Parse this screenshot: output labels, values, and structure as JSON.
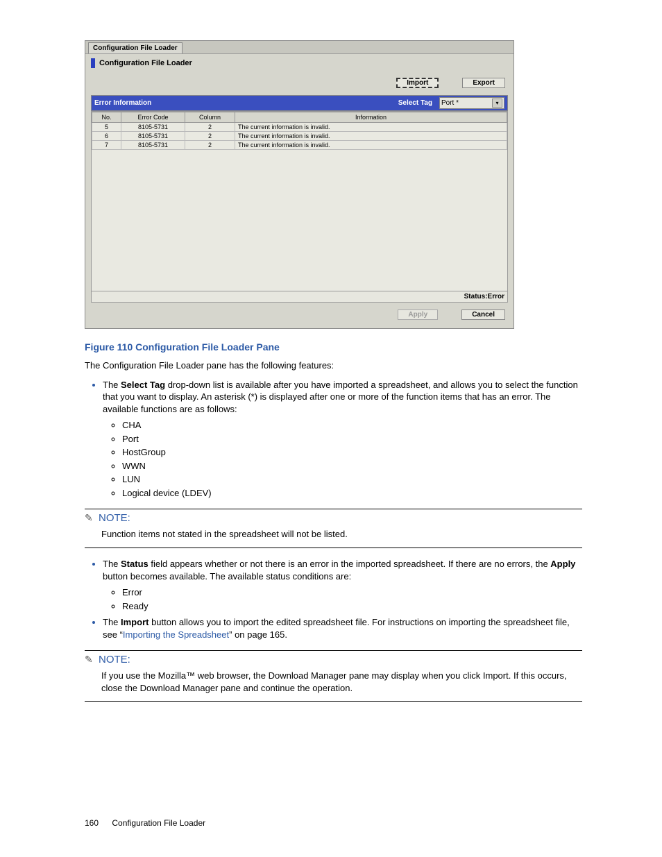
{
  "screenshot": {
    "tab_label": "Configuration File Loader",
    "pane_title": "Configuration File Loader",
    "btn_import": "Import",
    "btn_export": "Export",
    "section_title": "Error Information",
    "select_tag_label": "Select Tag",
    "select_tag_value": "Port  *",
    "columns": {
      "no": "No.",
      "err": "Error Code",
      "col": "Column",
      "info": "Information"
    },
    "rows": [
      {
        "no": "5",
        "err": "8105-5731",
        "col": "2",
        "info": "The current  information is invalid."
      },
      {
        "no": "6",
        "err": "8105-5731",
        "col": "2",
        "info": "The current  information is invalid."
      },
      {
        "no": "7",
        "err": "8105-5731",
        "col": "2",
        "info": "The current  information is invalid."
      }
    ],
    "status_label": "Status:Error",
    "btn_apply": "Apply",
    "btn_cancel": "Cancel"
  },
  "caption": "Figure 110 Configuration File Loader Pane",
  "intro": "The Configuration File Loader pane has the following features:",
  "b1_pre": "The ",
  "b1_bold": "Select Tag",
  "b1_post": " drop-down list is available after you have imported a spreadsheet, and allows you to select the function that you want to display. An asterisk (*) is displayed after one or more of the function items that has an error. The available functions are as follows:",
  "funcs": [
    "CHA",
    "Port",
    "HostGroup",
    "WWN",
    "LUN",
    "Logical device (LDEV)"
  ],
  "note1_head": "NOTE:",
  "note1_body": "Function items not stated in the spreadsheet will not be listed.",
  "b2_pre": "The ",
  "b2_bold1": "Status",
  "b2_mid": " field appears whether or not there is an error in the imported spreadsheet. If there are no errors, the ",
  "b2_bold2": "Apply",
  "b2_post": " button becomes available. The available status conditions are:",
  "status_items": [
    "Error",
    "Ready"
  ],
  "b3_pre": "The ",
  "b3_bold": "Import",
  "b3_mid": " button allows you to import the edited spreadsheet file. For instructions on importing the spreadsheet file, see “",
  "b3_link": "Importing the Spreadsheet",
  "b3_post": "” on page 165.",
  "note2_head": "NOTE:",
  "note2_body": "If you use the Mozilla™ web browser, the Download Manager pane may display when you click Import. If this occurs, close the Download Manager pane and continue the operation.",
  "page_num": "160",
  "footer_title": "Configuration File Loader"
}
